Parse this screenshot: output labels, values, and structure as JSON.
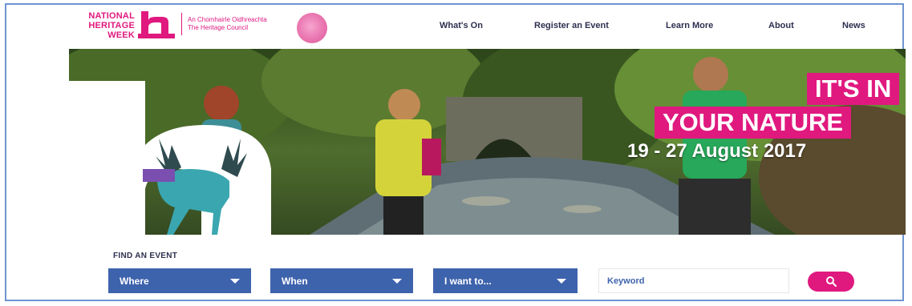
{
  "header": {
    "logo_line1": "NATIONAL",
    "logo_line2": "HERITAGE",
    "logo_line3": "WEEK",
    "council_irish": "An Chomhairle Oidhreachta",
    "council_english": "The Heritage Council"
  },
  "nav": {
    "items": [
      "What's On",
      "Register an Event",
      "Learn More",
      "About",
      "News"
    ]
  },
  "hero": {
    "tagline_line1": "IT'S IN",
    "tagline_line2": "YOUR NATURE",
    "dates": "19 - 27 August 2017"
  },
  "find_event": {
    "label": "FIND AN EVENT",
    "where": "Where",
    "when": "When",
    "i_want_to": "I want to...",
    "keyword_placeholder": "Keyword"
  },
  "colors": {
    "brand_pink": "#e0197f",
    "dropdown_blue": "#3e63ad",
    "nav_text": "#2e3050"
  }
}
